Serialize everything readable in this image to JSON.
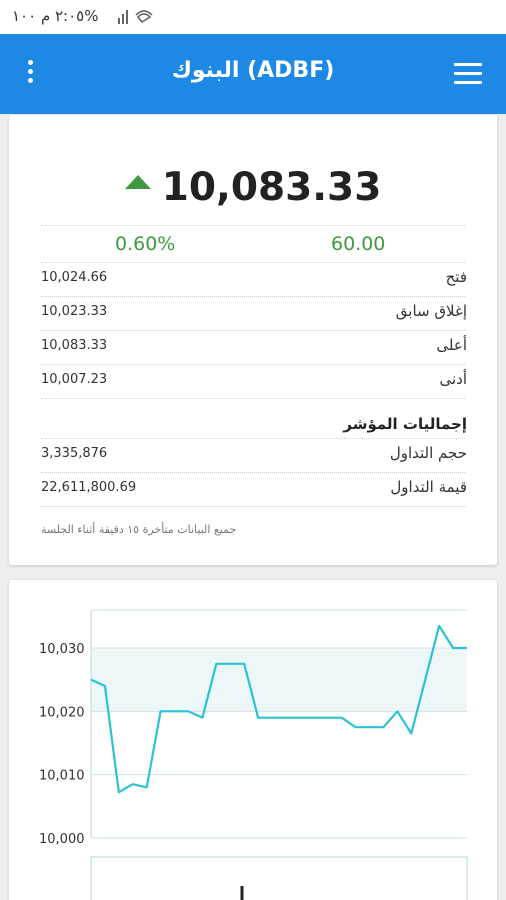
{
  "status_bar": {
    "time_battery": "٢:٠٥ م  ١٠٠%"
  },
  "app_bar": {
    "title": "البنوك (ADBF)"
  },
  "quote": {
    "price": "10,083.33",
    "direction": "up",
    "change_pct": "0.60%",
    "change_abs": "60.00",
    "up_color": "#3f9a3f"
  },
  "details": [
    {
      "label": "فتح",
      "value": "10,024.66"
    },
    {
      "label": "إغلاق سابق",
      "value": "10,023.33"
    },
    {
      "label": "أعلى",
      "value": "10,083.33"
    },
    {
      "label": "أدنى",
      "value": "10,007.23"
    }
  ],
  "totals": {
    "heading": "إجماليات المؤشر",
    "rows": [
      {
        "label": "حجم التداول",
        "value": "3,335,876"
      },
      {
        "label": "قيمة التداول",
        "value": "22,611,800.69"
      }
    ]
  },
  "note": "جميع البيانات متأخرة ١٥ دقيقة أثناء الجلسة",
  "colors": {
    "app_bar": "#1e88e5",
    "line": "#2bc3d2"
  },
  "chart_data": {
    "type": "line",
    "ylim": [
      10000,
      10036
    ],
    "yticks": [
      "10,000",
      "10,010",
      "10,020",
      "10,030"
    ],
    "ytick_values": [
      10000,
      10010,
      10020,
      10030
    ],
    "series": [
      {
        "values": [
          10025,
          10024,
          10007.23,
          10008.5,
          10008,
          10020,
          10020,
          10020,
          10019,
          10027.5,
          10027.5,
          10027.5,
          10019,
          10019,
          10019,
          10019,
          10019,
          10019,
          10019,
          10017.5,
          10017.5,
          10017.5,
          10020,
          10016.5,
          10025,
          10033.5,
          10030,
          10030
        ]
      }
    ],
    "xlim": [
      0,
      27
    ],
    "grid": true
  }
}
